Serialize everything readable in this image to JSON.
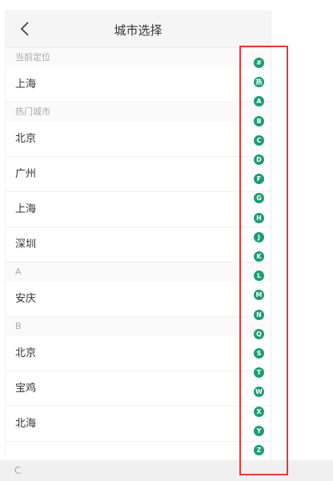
{
  "header": {
    "title": "城市选择",
    "back_icon": "chevron-left-icon"
  },
  "current": {
    "section": "当前定位",
    "city": "上海"
  },
  "hot": {
    "section": "热门城市",
    "cities": [
      "北京",
      "广州",
      "上海",
      "深圳"
    ]
  },
  "group_a": {
    "section": "A",
    "cities": [
      "安庆"
    ]
  },
  "group_b": {
    "section": "B",
    "cities": [
      "北京",
      "宝鸡",
      "北海"
    ]
  },
  "group_c": {
    "section": "C"
  },
  "index_bar": {
    "letters": [
      "#",
      "热",
      "A",
      "B",
      "C",
      "D",
      "F",
      "G",
      "H",
      "J",
      "K",
      "L",
      "M",
      "N",
      "Q",
      "S",
      "T",
      "W",
      "X",
      "Y",
      "Z"
    ]
  },
  "colors": {
    "index_badge": "#1f9d6c",
    "highlight_box": "#e53935"
  }
}
